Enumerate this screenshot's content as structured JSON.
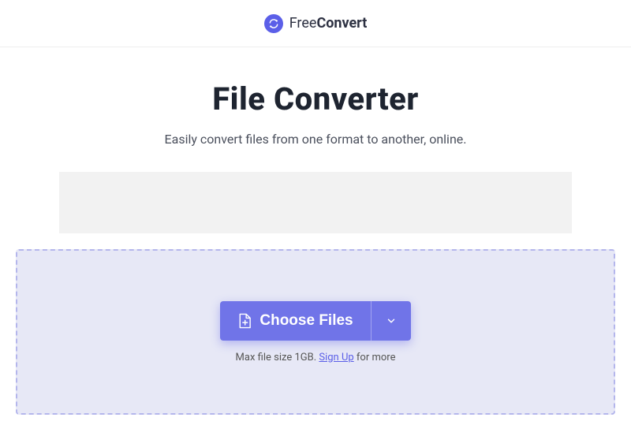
{
  "header": {
    "logo_prefix": "Free",
    "logo_suffix": "Convert"
  },
  "hero": {
    "title": "File Converter",
    "subtitle": "Easily convert files from one format to another, online."
  },
  "dropzone": {
    "button_label": "Choose Files",
    "info_prefix": "Max file size 1GB. ",
    "signup_label": "Sign Up",
    "info_suffix": " for more"
  }
}
